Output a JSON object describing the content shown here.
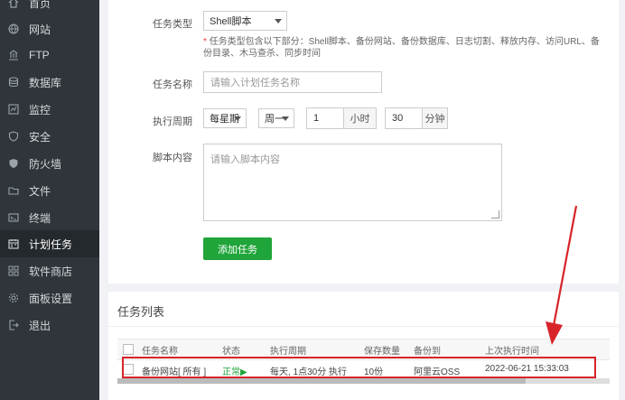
{
  "sidebar": {
    "items": [
      {
        "label": "首页",
        "icon": "home-icon"
      },
      {
        "label": "网站",
        "icon": "globe-icon"
      },
      {
        "label": "FTP",
        "icon": "ftp-icon"
      },
      {
        "label": "数据库",
        "icon": "database-icon"
      },
      {
        "label": "监控",
        "icon": "monitor-icon"
      },
      {
        "label": "安全",
        "icon": "shield-icon"
      },
      {
        "label": "防火墙",
        "icon": "firewall-icon"
      },
      {
        "label": "文件",
        "icon": "folder-icon"
      },
      {
        "label": "终端",
        "icon": "terminal-icon"
      },
      {
        "label": "计划任务",
        "icon": "calendar-icon",
        "active": true
      },
      {
        "label": "软件商店",
        "icon": "grid-icon"
      },
      {
        "label": "面板设置",
        "icon": "settings-icon"
      },
      {
        "label": "退出",
        "icon": "logout-icon"
      }
    ]
  },
  "form": {
    "task_type_label": "任务类型",
    "task_type_value": "Shell脚本",
    "hint_star": "*",
    "hint_text": "任务类型包含以下部分：Shell脚本、备份网站、备份数据库、日志切割、释放内存、访问URL、备份目录、木马查杀、同步时间",
    "task_name_label": "任务名称",
    "task_name_placeholder": "请输入计划任务名称",
    "period_label": "执行周期",
    "period_value": "每星期",
    "weekday_value": "周一",
    "hour_value": "1",
    "hour_unit": "小时",
    "minute_value": "30",
    "minute_unit": "分钟",
    "script_label": "脚本内容",
    "script_placeholder": "请输入脚本内容",
    "add_button": "添加任务"
  },
  "list": {
    "title": "任务列表",
    "columns": [
      "任务名称",
      "状态",
      "执行周期",
      "保存数量",
      "备份到",
      "上次执行时间"
    ],
    "rows": [
      {
        "name": "备份网站[ 所有 ]",
        "status": "正常▶",
        "period": "每天, 1点30分 执行",
        "count": "10份",
        "backup_to": "阿里云OSS",
        "last_run": "2022-06-21 15:33:03"
      }
    ]
  },
  "colors": {
    "accent": "#20a53a",
    "highlight": "#d9232a",
    "sidebar_bg": "#2f353a"
  }
}
